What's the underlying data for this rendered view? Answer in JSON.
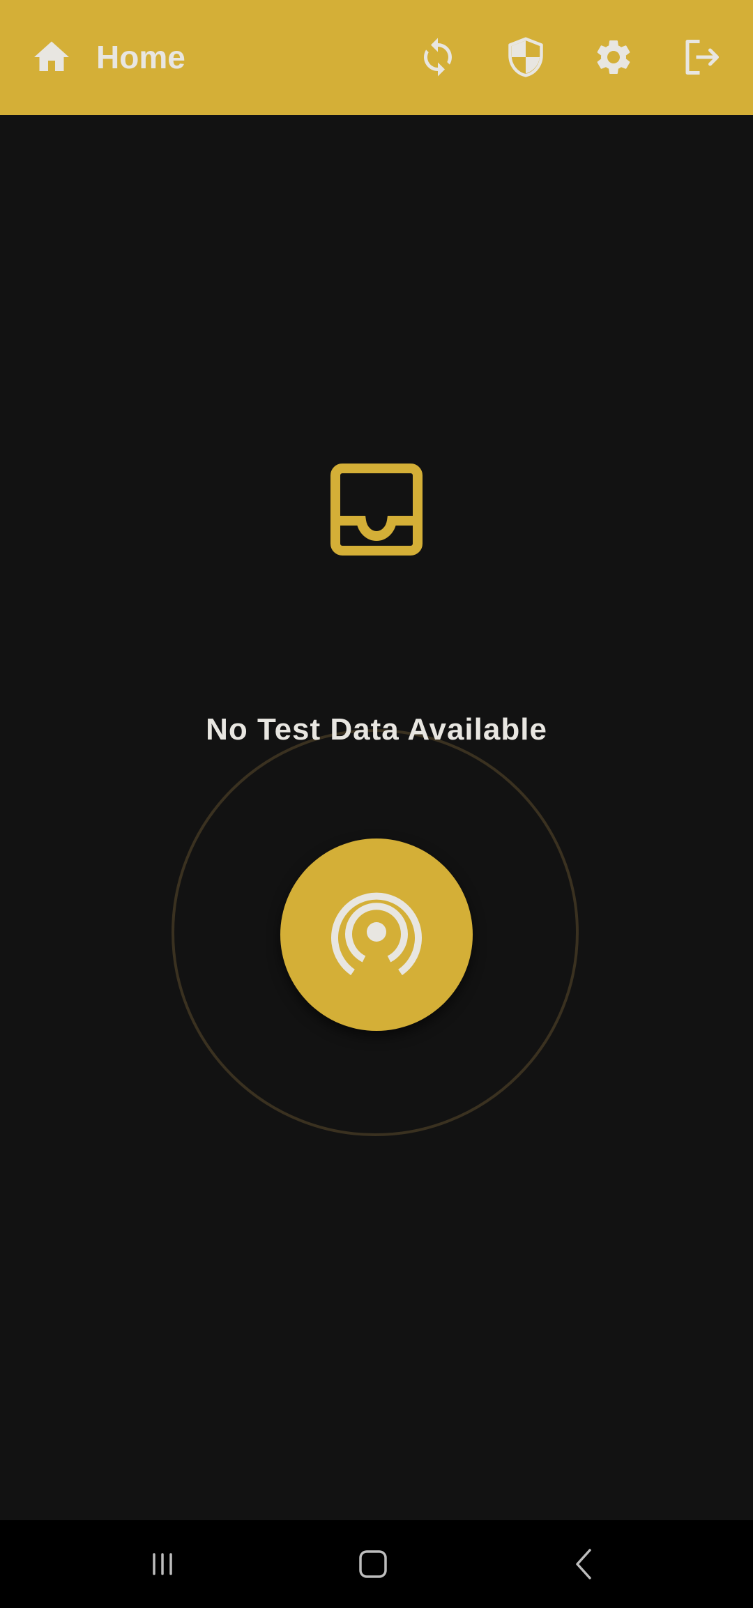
{
  "colors": {
    "accent": "#d4af37",
    "background": "#121212",
    "text": "#e8e6e1",
    "navbar": "#000000"
  },
  "toolbar": {
    "title": "Home",
    "icons": [
      "home-icon",
      "sync-icon",
      "shield-icon",
      "gear-icon",
      "logout-icon"
    ]
  },
  "empty_state": {
    "icon": "inbox-icon",
    "message": "No Test Data Available"
  },
  "start_button": {
    "icon": "broadcast-icon"
  },
  "system_nav": {
    "icons": [
      "recent-apps-icon",
      "home-nav-icon",
      "back-icon"
    ]
  }
}
